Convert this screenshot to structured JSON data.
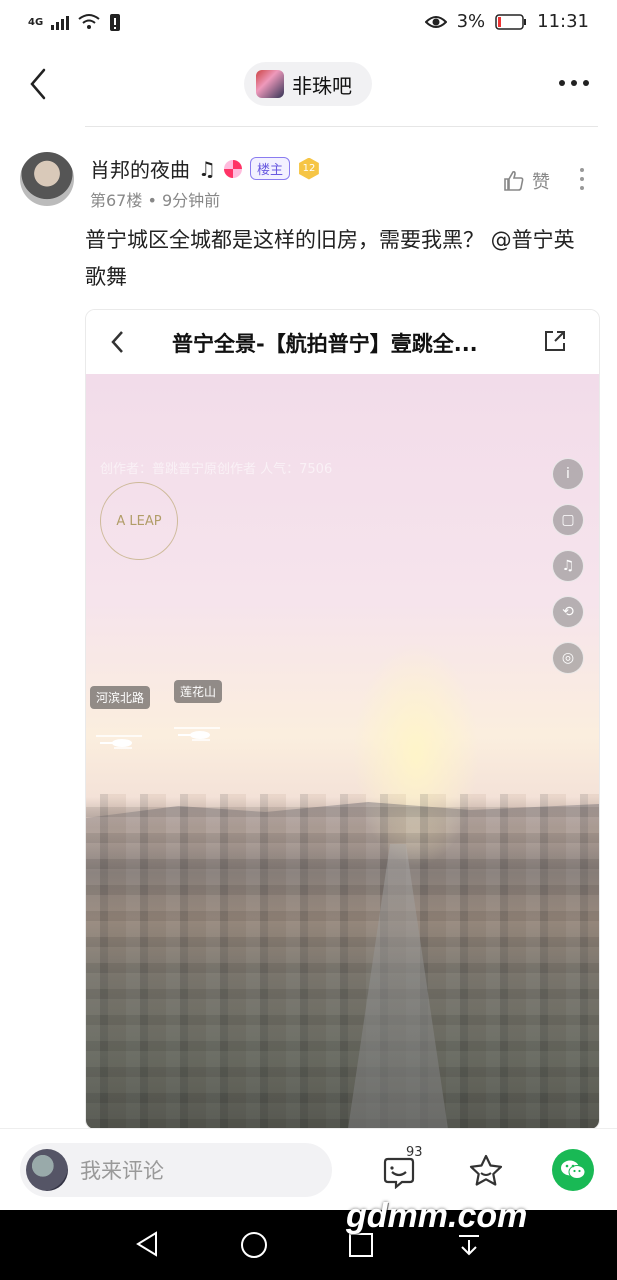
{
  "status": {
    "network": "4G",
    "battery": "3%",
    "time": "11:31"
  },
  "nav": {
    "forum_name": "非珠吧"
  },
  "post": {
    "username": "肖邦的夜曲",
    "note_icon": "♫",
    "tag": "楼主",
    "level": "12",
    "floor": "第67楼",
    "dot": "•",
    "time": "9分钟前",
    "like_label": "赞",
    "text": "普宁城区全城都是这样的旧房，需要我黑？ @普宁英歌舞"
  },
  "embedded": {
    "title": "普宁全景-【航拍普宁】壹跳全...",
    "watermark": "创作者：普跳普宁原创作者  人气：7506",
    "logo_text": "A LEAP",
    "labels": [
      "河滨北路",
      "莲花山"
    ],
    "side_icons": [
      "info-icon",
      "crop-icon",
      "music-icon",
      "gyro-icon",
      "vr-icon"
    ]
  },
  "bottom": {
    "comment_placeholder": "我来评论",
    "comment_count": "93"
  },
  "overlay": {
    "site": "gdmm.com"
  }
}
